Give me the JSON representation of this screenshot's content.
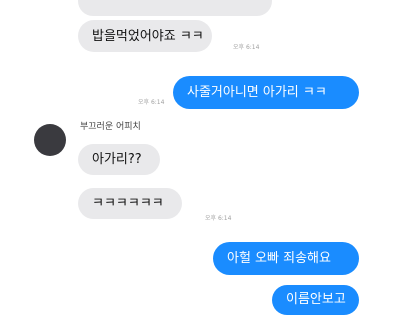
{
  "chat": {
    "msg_top_clipped": "",
    "msg1": "밥을먹었어야죠 ㅋㅋ",
    "time1": "오후 6:14",
    "msg2": "사줄거아니면 아가리 ㅋㅋ",
    "time2": "오후 6:14",
    "sender_name": "부끄러운 어피치",
    "msg3": "아가리??",
    "msg4": "ㅋㅋㅋㅋㅋㅋ",
    "time3": "오후 6:14",
    "msg5": "아헐 오빠 죄송해요",
    "msg6_clipped": "이름안보고"
  },
  "colors": {
    "outgoing_bubble": "#1a8cff",
    "incoming_bubble": "#e9e9eb"
  }
}
